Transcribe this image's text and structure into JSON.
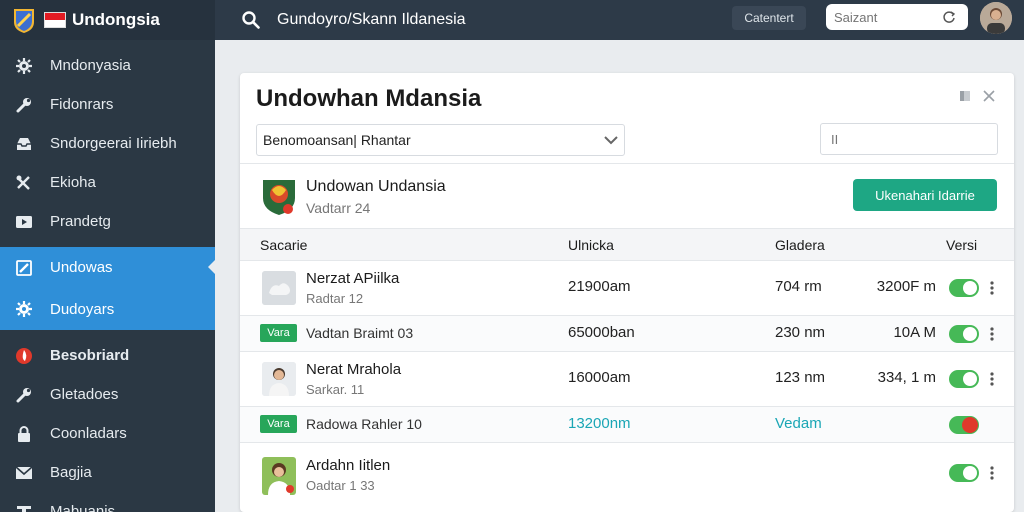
{
  "topbar": {
    "brand_title": "Undongsia",
    "page_title": "Gundoyro/Skann Ildanesia",
    "button_label": "Catentert",
    "search_placeholder": "Saizant"
  },
  "sidebar": {
    "items": [
      {
        "label": "Mndonyasia",
        "icon": "gear-icon"
      },
      {
        "label": "Fidonrars",
        "icon": "wrench-icon"
      },
      {
        "label": "Sndorgeerai Iiriebh",
        "icon": "inbox-icon"
      },
      {
        "label": "Ekioha",
        "icon": "tools-icon"
      },
      {
        "label": "Prandetg",
        "icon": "video-icon"
      },
      {
        "label": "Undowas",
        "icon": "edit-icon"
      },
      {
        "label": "Dudoyars",
        "icon": "gear-icon"
      },
      {
        "label": "Besobriard",
        "icon": "flame-icon"
      },
      {
        "label": "Gletadoes",
        "icon": "wrench-icon"
      },
      {
        "label": "Coonladars",
        "icon": "lock-icon"
      },
      {
        "label": "Bagjia",
        "icon": "mail-icon"
      },
      {
        "label": "Mabuanis",
        "icon": "text-icon"
      }
    ]
  },
  "card": {
    "title": "Undowhan Mdansia",
    "select_value": "Benomoansan| Rhantar",
    "filter_placeholder": "II",
    "app_name": "Undowan Undansia",
    "app_version": "Vadtarr 24",
    "primary_button": "Ukenahari Idarrie",
    "columns": [
      "Sacarie",
      "Ulnicka",
      "Gladera",
      "Versi"
    ],
    "rows": [
      {
        "type": "item",
        "name": "Nerzat APiilka",
        "sub": "Radtar 12",
        "c1": "21900am",
        "c2": "704 rm",
        "c3": "3200F m",
        "kebab": true
      },
      {
        "type": "label",
        "badge": "Vara",
        "name": "Vadtan Braimt 03",
        "c1": "65000ban",
        "c2": "230 nm",
        "c3": "10A M",
        "kebab": true
      },
      {
        "type": "item",
        "name": "Nerat Mrahola",
        "sub": "Sarkar. 11",
        "c1": "16000am",
        "c2": "123 nm",
        "c3": "334, 1 m",
        "kebab": true
      },
      {
        "type": "label",
        "badge": "Vara",
        "name": "Radowa Rahler 10",
        "c1": "13200nm",
        "c2": "Vedam",
        "c3": "",
        "kebab": false
      },
      {
        "type": "item",
        "name": "Ardahn Iitlen",
        "sub": "Oadtar 1 33",
        "c1": "",
        "c2": "",
        "c3": "",
        "kebab": true
      }
    ]
  },
  "colors": {
    "topbar": "#2d3a48",
    "sidebar": "#2b3844",
    "active": "#2f8fd8",
    "primary": "#1ea784",
    "toggle": "#46b957",
    "badge": "#27a65a",
    "teal": "#1aa6b5"
  }
}
